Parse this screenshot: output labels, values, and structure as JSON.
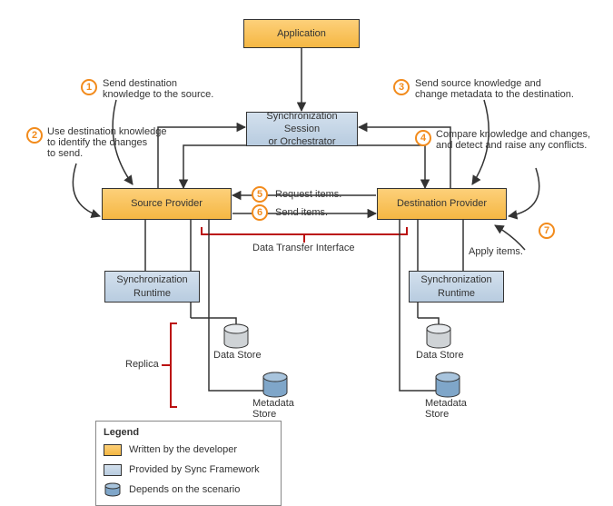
{
  "application": "Application",
  "session": "Synchronization Session\nor Orchestrator",
  "source_provider": "Source Provider",
  "dest_provider": "Destination Provider",
  "sync_runtime_left": "Synchronization\nRuntime",
  "sync_runtime_right": "Synchronization\nRuntime",
  "data_store": "Data Store",
  "metadata_store": "Metadata\nStore",
  "replica": "Replica",
  "dti": "Data Transfer Interface",
  "steps": {
    "1": "Send destination\nknowledge to the source.",
    "2": "Use destination knowledge\nto identify the changes\nto send.",
    "3": "Send source knowledge and\nchange metadata to the destination.",
    "4": "Compare knowledge and changes,\nand detect and raise any conflicts.",
    "5": "Request items.",
    "6": "Send items.",
    "7": "Apply items."
  },
  "legend": {
    "title": "Legend",
    "dev": "Written by the developer",
    "fw": "Provided by Sync Framework",
    "dep": "Depends on the scenario"
  }
}
